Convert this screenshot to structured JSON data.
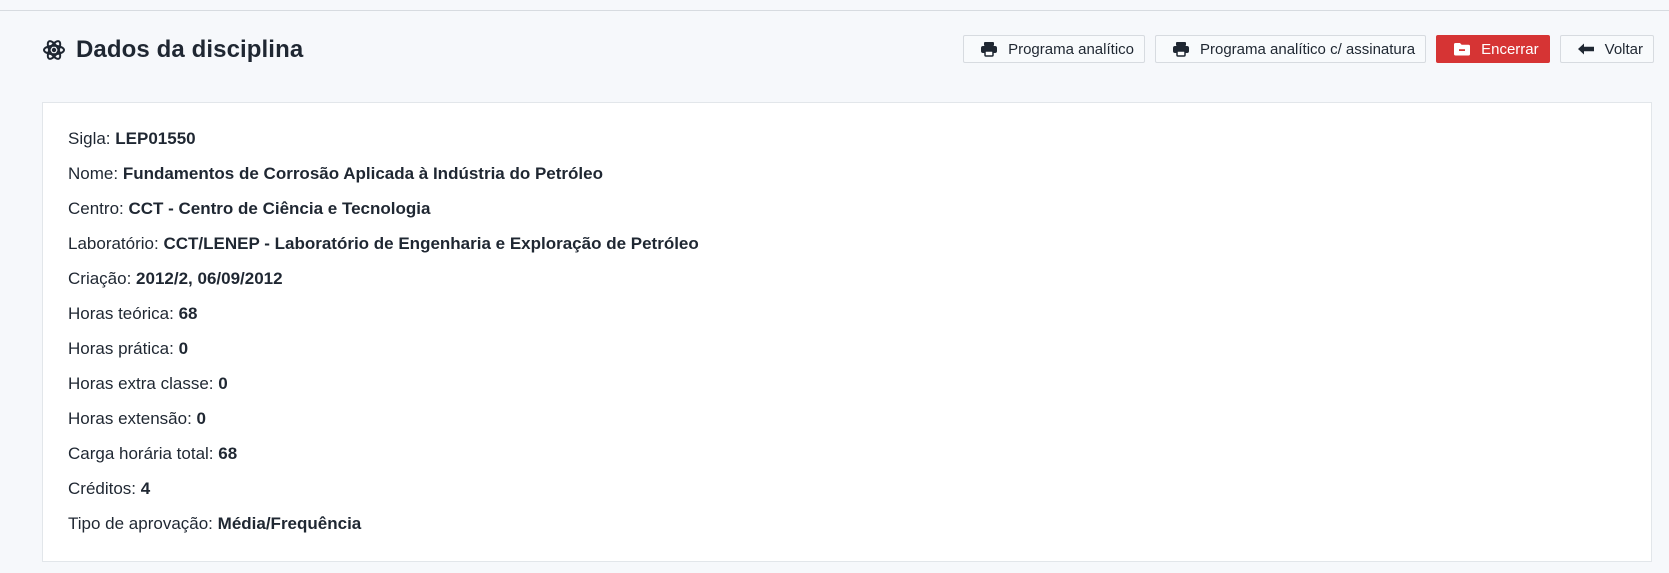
{
  "page": {
    "title": "Dados da disciplina",
    "title_icon": "atom-icon"
  },
  "actions": [
    {
      "key": "programa",
      "label": "Programa analítico",
      "icon": "printer-icon"
    },
    {
      "key": "programa_assinatura",
      "label": "Programa analítico c/ assinatura",
      "icon": "printer-icon"
    },
    {
      "key": "encerrar",
      "label": "Encerrar",
      "icon": "folder-minus-icon"
    },
    {
      "key": "voltar",
      "label": "Voltar",
      "icon": "arrow-left-icon"
    }
  ],
  "details": [
    {
      "label": "Sigla:",
      "value": "LEP01550"
    },
    {
      "label": "Nome:",
      "value": "Fundamentos de Corrosão Aplicada à Indústria do Petróleo"
    },
    {
      "label": "Centro:",
      "value": "CCT - Centro de Ciência e Tecnologia"
    },
    {
      "label": "Laboratório:",
      "value": "CCT/LENEP - Laboratório de Engenharia e Exploração de Petróleo"
    },
    {
      "label": "Criação:",
      "value": "2012/2, 06/09/2012"
    },
    {
      "label": "Horas teórica:",
      "value": "68"
    },
    {
      "label": "Horas prática:",
      "value": "0"
    },
    {
      "label": "Horas extra classe:",
      "value": "0"
    },
    {
      "label": "Horas extensão:",
      "value": "0"
    },
    {
      "label": "Carga horária total:",
      "value": "68"
    },
    {
      "label": "Créditos:",
      "value": "4"
    },
    {
      "label": "Tipo de aprovação:",
      "value": "Média/Frequência"
    }
  ],
  "colors": {
    "background": "#f6f8fb",
    "panel": "#ffffff",
    "border": "#d7dbe0",
    "danger": "#d63434",
    "text": "#1f2732"
  }
}
